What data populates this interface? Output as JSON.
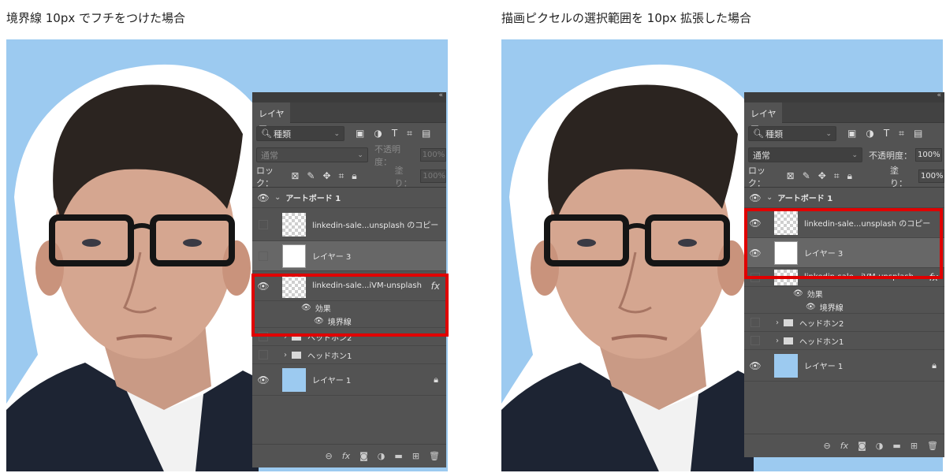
{
  "captions": {
    "left": "境界線 10px でフチをつけた場合",
    "right": "描画ピクセルの選択範囲を 10px 拡張した場合"
  },
  "colors": {
    "background_blue": "#9ccaf0",
    "panel_gray": "#535353",
    "highlight_red": "#e00000"
  },
  "panel_left": {
    "tab": "レイヤー",
    "filter_kind": "種類",
    "blend_mode": "通常",
    "opacity_label": "不透明度：",
    "opacity_value": "100%",
    "lock_label": "ロック：",
    "fill_label": "塗り：",
    "fill_value": "100%",
    "artboard": "アートボード 1",
    "layers": [
      {
        "name": "linkedin-sale...unsplash のコピー"
      },
      {
        "name": "レイヤー 3"
      },
      {
        "name": "linkedin-sale...iVM-unsplash",
        "fx": "fx"
      },
      {
        "name": "ヘッドホン2"
      },
      {
        "name": "ヘッドホン1"
      },
      {
        "name": "レイヤー 1"
      }
    ],
    "effects_label": "効果",
    "stroke_label": "境界線"
  },
  "panel_right": {
    "tab": "レイヤー",
    "filter_kind": "種類",
    "blend_mode": "通常",
    "opacity_label": "不透明度：",
    "opacity_value": "100%",
    "lock_label": "ロック：",
    "fill_label": "塗り：",
    "fill_value": "100%",
    "artboard": "アートボード 1",
    "layers": [
      {
        "name": "linkedin-sale...unsplash のコピー"
      },
      {
        "name": "レイヤー 3"
      },
      {
        "name": "linkedin-sale...iVM-unsplash",
        "fx": "fx"
      },
      {
        "name": "ヘッドホン2"
      },
      {
        "name": "ヘッドホン1"
      },
      {
        "name": "レイヤー 1"
      }
    ],
    "effects_label": "効果",
    "stroke_label": "境界線"
  }
}
